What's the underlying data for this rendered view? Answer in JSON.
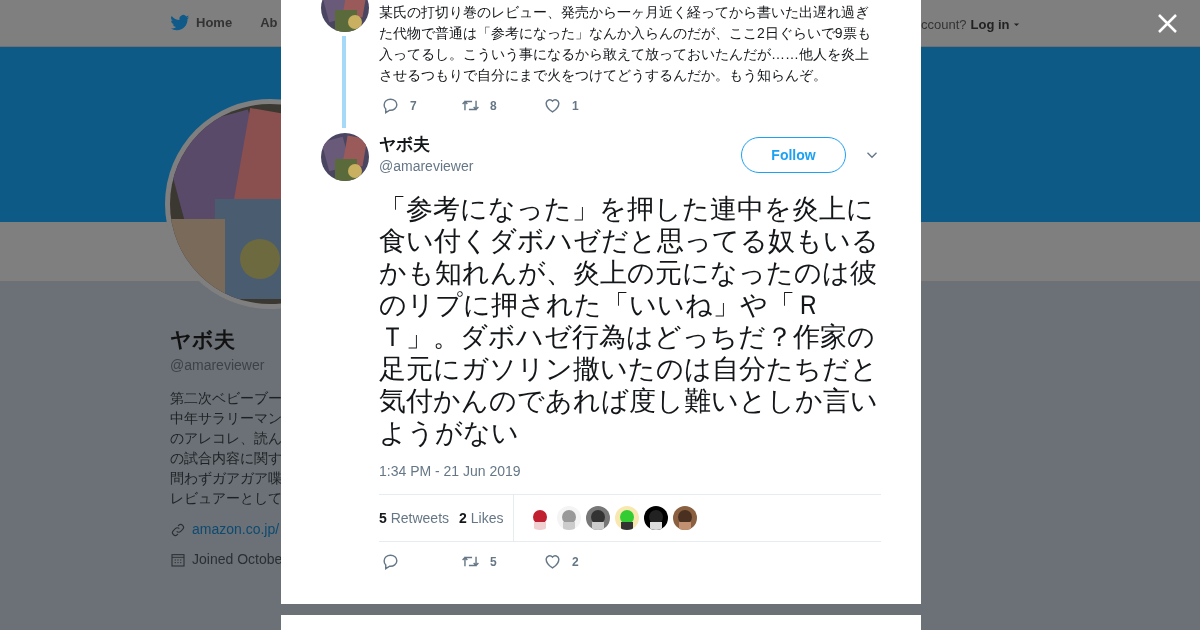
{
  "top_nav": {
    "items": [
      "Home",
      "Ab"
    ],
    "login_prompt": "ccount?",
    "login": "Log in"
  },
  "profile": {
    "name": "ヤボ夫",
    "handle": "@amareviewer",
    "bio_lines": [
      "第二次ベビーブー",
      "中年サラリーマン",
      "のアレコレ、読ん",
      "の試合内容に関す",
      "問わずガアガア喋",
      "レビュアーとして"
    ],
    "link": "amazon.co.jp/",
    "joined": "Joined Octobe"
  },
  "parent_tweet": {
    "text": "某氏の打切り巻のレビュー、発売から一ヶ月近く経ってから書いた出遅れ過ぎた代物で普通は「参考になった」なんか入らんのだが、ここ2日ぐらいで9票も入ってるし。こういう事になるから敢えて放っておいたんだが……他人を炎上させるつもりで自分にまで火をつけてどうするんだか。もう知らんぞ。",
    "actions": [
      {
        "kind": "reply",
        "count": "7"
      },
      {
        "kind": "retweet",
        "count": "8"
      },
      {
        "kind": "like",
        "count": "1"
      }
    ]
  },
  "tweet": {
    "name": "ヤボ夫",
    "handle": "@amareviewer",
    "follow": "Follow",
    "text": "「参考になった」を押した連中を炎上に食い付くダボハゼだと思ってる奴もいるかも知れんが、炎上の元になったのは彼のリプに押された「いいね」や「ＲＴ」。ダボハゼ行為はどっちだ？作家の足元にガソリン撒いたのは自分たちだと気付かんのであれば度し難いとしか言いようがない",
    "time": "1:34 PM - 21 Jun 2019",
    "stats": [
      {
        "count": "5",
        "label": "Retweets"
      },
      {
        "count": "2",
        "label": "Likes"
      }
    ],
    "actions": [
      {
        "kind": "reply"
      },
      {
        "kind": "retweet",
        "count": "5"
      },
      {
        "kind": "like",
        "count": "2"
      }
    ]
  }
}
